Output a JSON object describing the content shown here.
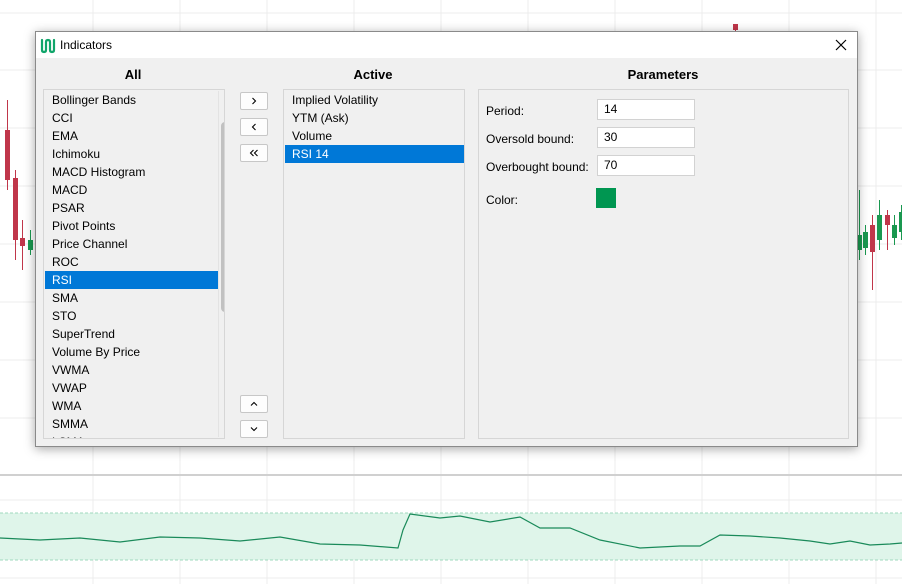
{
  "window": {
    "title": "Indicators"
  },
  "columns": {
    "all": "All",
    "active": "Active",
    "parameters": "Parameters"
  },
  "all_indicators": [
    "Bollinger Bands",
    "CCI",
    "EMA",
    "Ichimoku",
    "MACD Histogram",
    "MACD",
    "PSAR",
    "Pivot Points",
    "Price Channel",
    "ROC",
    "RSI",
    "SMA",
    "STO",
    "SuperTrend",
    "Volume By Price",
    "VWMA",
    "VWAP",
    "WMA",
    "SMMA",
    "LSMA"
  ],
  "all_selected_index": 10,
  "active_indicators": [
    "Implied Volatility",
    "YTM (Ask)",
    "Volume",
    "RSI 14"
  ],
  "active_selected_index": 3,
  "buttons": {
    "add": ">",
    "remove": "<",
    "remove_all": "«",
    "move_up": "^",
    "move_down": "v"
  },
  "parameters": {
    "period": {
      "label": "Period:",
      "value": "14"
    },
    "oversold": {
      "label": "Oversold bound:",
      "value": "30"
    },
    "overbought": {
      "label": "Overbought bound:",
      "value": "70"
    },
    "color": {
      "label": "Color:",
      "value": "#009651"
    }
  },
  "colors": {
    "accent": "#0078d7",
    "candle_up": "#1a9850",
    "candle_down": "#c0364a",
    "rsi_line": "#1a8a5a",
    "rsi_band": "#dff5ea",
    "color_swatch": "#009651"
  }
}
